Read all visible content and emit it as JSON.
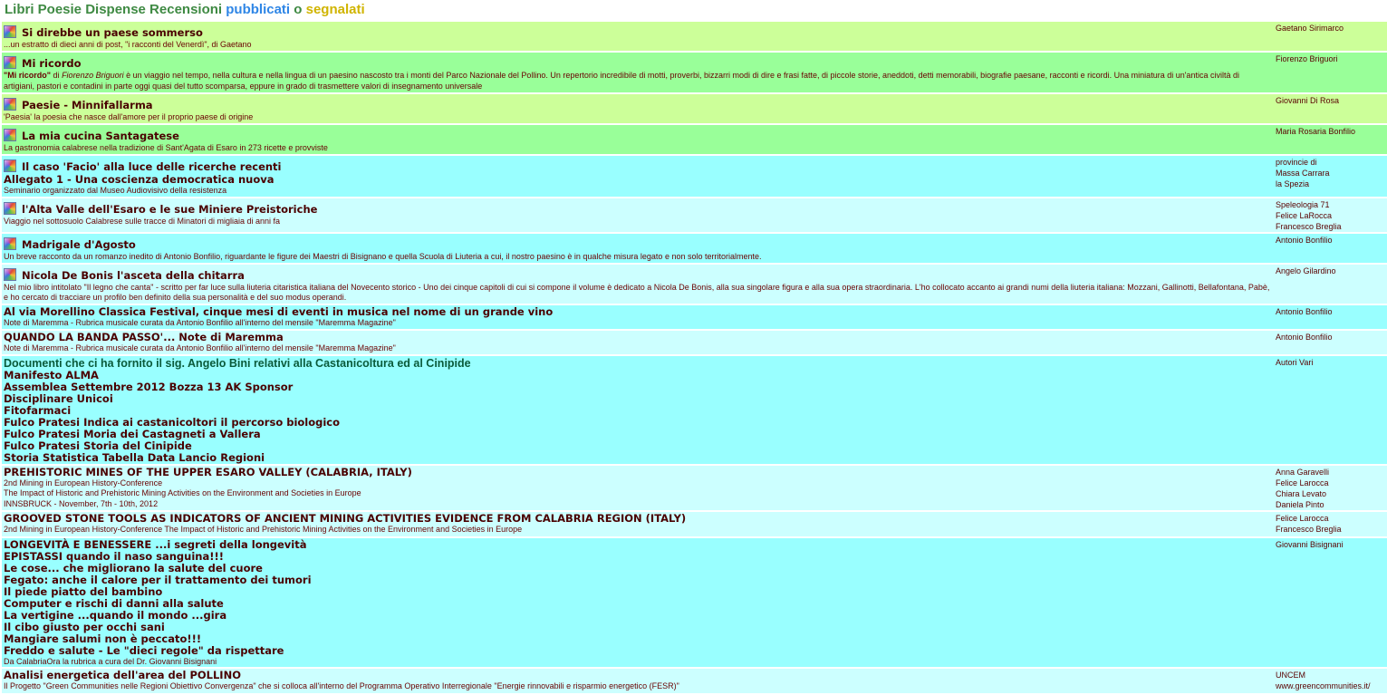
{
  "header": {
    "title_main": "Libri Poesie Dispense Recensioni",
    "title_pub": "pubblicati",
    "title_o": "o",
    "title_seg": "segnalati"
  },
  "rows": [
    {
      "title": "Si direbbe un paese sommerso",
      "desc": "...un estratto di dieci anni di post, \"i racconti del Venerdì\", di Gaetano",
      "authors": [
        "Gaetano Sirimarco"
      ]
    },
    {
      "title": "Mi ricordo",
      "desc_lead": "\"Mi ricordo\"",
      "desc_di": " di ",
      "desc_author": "Fiorenzo Briguori",
      "desc": " è un viaggio nel tempo, nella cultura e nella lingua di un paesino nascosto tra i monti del Parco Nazionale del Pollino. Un repertorio incredibile di motti, proverbi, bizzarri modi di dire e frasi fatte, di piccole storie, aneddoti, detti memorabili, biografie paesane, racconti e ricordi. Una miniatura di un'antica civiltà di artigiani, pastori e contadini in parte oggi quasi del tutto scomparsa, eppure in grado di trasmettere valori di insegnamento universale",
      "authors": [
        "Fiorenzo Briguori"
      ]
    },
    {
      "title": "Paesie - Minnifallarma",
      "desc": "'Paesia' la poesia che nasce dall'amore per il proprio paese di origine",
      "authors": [
        "Giovanni Di Rosa"
      ]
    },
    {
      "title": "La mia cucina Santagatese",
      "desc": "La gastronomia calabrese nella tradizione di Sant'Agata di Esaro in 273 ricette e provviste",
      "authors": [
        "Maria Rosaria Bonfilio"
      ]
    },
    {
      "title": "Il caso 'Facio' alla luce delle ricerche recenti",
      "title2": "Allegato 1 - Una coscienza democratica nuova",
      "desc": "Seminario organizzato dal Museo Audiovisivo della resistenza",
      "authors": [
        "provincie di",
        "Massa Carrara",
        "la Spezia"
      ]
    },
    {
      "title": "l'Alta Valle dell'Esaro e le sue Miniere Preistoriche",
      "desc": "Viaggio nel sottosuolo Calabrese sulle tracce di Minatori di migliaia di anni fa",
      "authors": [
        "Speleologia 71",
        "Felice LaRocca",
        "Francesco Breglia"
      ]
    },
    {
      "title": "Madrigale d'Agosto",
      "desc": "Un breve racconto da un romanzo inedito di Antonio Bonfilio, riguardante le figure dei Maestri di Bisignano e quella Scuola di Liuteria a cui, il nostro paesino è in qualche misura legato e non solo territorialmente.",
      "authors": [
        "Antonio Bonfilio"
      ]
    },
    {
      "title": "Nicola De Bonis l'asceta della chitarra",
      "desc": "Nel mio libro intitolato \"Il legno che canta\" - scritto per far luce sulla liuteria citaristica italiana del Novecento storico - Uno dei cinque capitoli di cui si compone il volume è dedicato a Nicola De Bonis, alla sua singolare figura e alla sua opera straordinaria. L'ho collocato accanto ai grandi numi della liuteria italiana: Mozzani, Gallinotti, Bellafontana, Pabè, e ho cercato di tracciare un profilo ben definito della sua personalità e del suo modus operandi.",
      "authors": [
        "Angelo Gilardino"
      ]
    },
    {
      "title": "Al via Morellino Classica Festival, cinque mesi di eventi in musica nel nome di un grande vino",
      "desc": "Note di Maremma - Rubrica musicale curata da Antonio Bonfilio all'interno del mensile \"Maremma Magazine\"",
      "authors": [
        "Antonio Bonfilio"
      ]
    },
    {
      "title": "QUANDO LA BANDA PASSO'... Note di Maremma",
      "desc": "Note di Maremma - Rubrica musicale curata da Antonio Bonfilio all'interno del mensile \"Maremma Magazine\"",
      "authors": [
        "Antonio Bonfilio"
      ]
    },
    {
      "heading": "Documenti che ci ha fornito il sig. Angelo Bini relativi alla Castanicoltura ed al Cinipide",
      "links": [
        "Manifesto ALMA",
        "Assemblea Settembre 2012 Bozza 13 AK Sponsor",
        "Disciplinare Unicoi",
        "Fitofarmaci",
        "Fulco Pratesi Indica ai castanicoltori il percorso biologico",
        "Fulco Pratesi Moria dei Castagneti a Vallera",
        "Fulco Pratesi Storia del Cinipide",
        "Storia Statistica Tabella Data Lancio Regioni"
      ],
      "authors": [
        "Autori Vari"
      ]
    },
    {
      "title": "PREHISTORIC MINES OF THE UPPER ESARO VALLEY (CALABRIA, ITALY)",
      "desc_lines": [
        "2nd Mining in European History-Conference",
        "The Impact of Historic and Prehistoric Mining Activities on the Environment and Societies in Europe",
        "INNSBRUCK - November, 7th - 10th, 2012"
      ],
      "authors": [
        "Anna Garavelli",
        "Felice Larocca",
        "Chiara Levato",
        "Daniela Pinto"
      ]
    },
    {
      "title": "GROOVED STONE TOOLS AS INDICATORS OF ANCIENT MINING ACTIVITIES EVIDENCE FROM CALABRIA REGION (ITALY)",
      "desc": "2nd Mining in European History-Conference The Impact of Historic and Prehistoric Mining Activities on the Environment and Societies in Europe",
      "authors": [
        "Felice Larocca",
        "Francesco Breglia"
      ]
    },
    {
      "links": [
        "LONGEVITÀ E BENESSERE ...i segreti della longevità",
        "EPISTASSI quando il naso sanguina!!!",
        "Le cose... che migliorano la salute del cuore",
        "Fegato: anche il calore per il trattamento dei tumori",
        "Il piede piatto del bambino",
        "Computer e rischi di danni alla salute",
        "La vertigine ...quando il mondo ...gira",
        "Il cibo giusto per occhi sani",
        "Mangiare salumi non è peccato!!!",
        "Freddo e salute - Le \"dieci regole\" da rispettare"
      ],
      "desc": "Da CalabriaOra la rubrica a cura del Dr. Giovanni Bisignani",
      "authors": [
        "Giovanni Bisignani"
      ]
    },
    {
      "title": "Analisi energetica dell'area del POLLINO",
      "desc": "Il Progetto \"Green Communities nelle Regioni Obiettivo Convergenza\" che si colloca all'interno del Programma Operativo Interregionale \"Energie rinnovabili e risparmio energetico (FESR)\"",
      "authors": [
        "UNCEM",
        "www.greencommunities.it/"
      ]
    }
  ]
}
